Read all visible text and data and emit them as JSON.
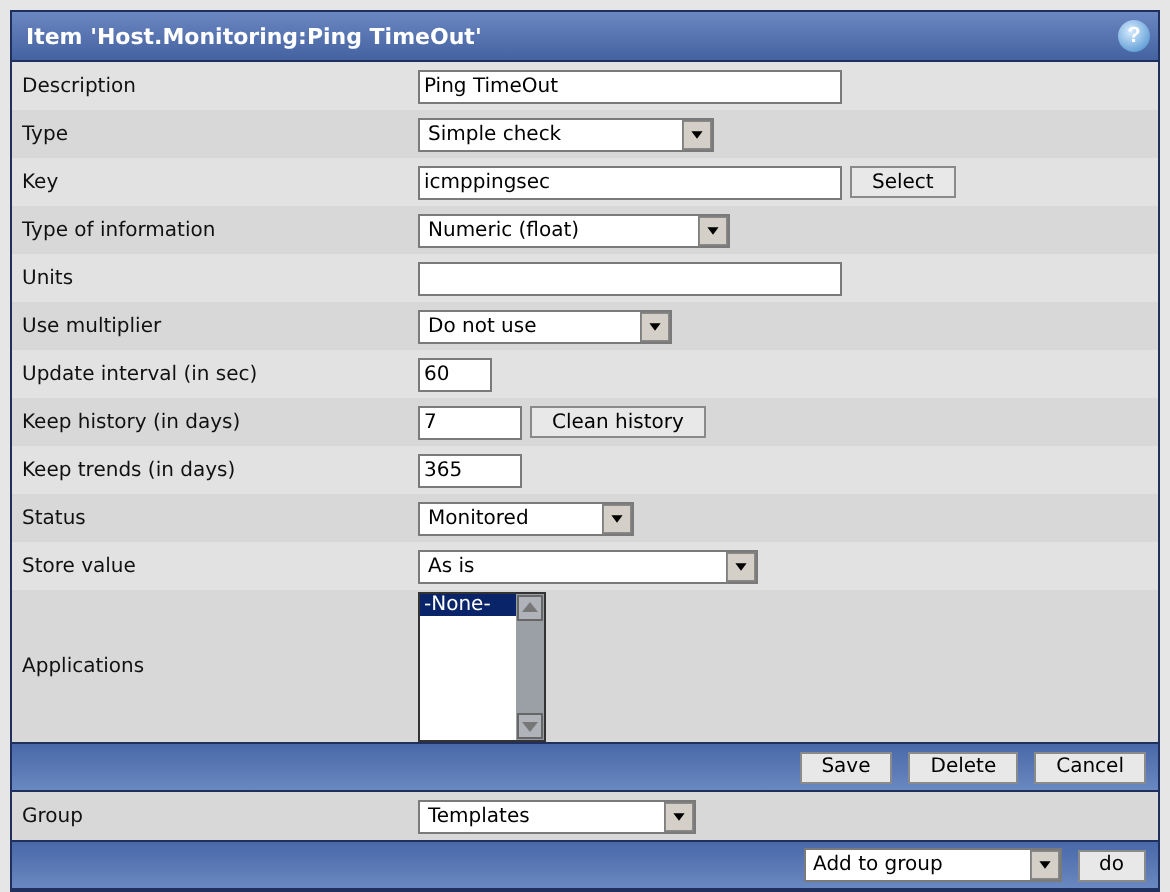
{
  "window": {
    "title": "Item 'Host.Monitoring:Ping TimeOut'",
    "help_button": "?"
  },
  "rows": [
    {
      "label": "Description",
      "kind": "input",
      "value": "Ping TimeOut"
    },
    {
      "label": "Type",
      "kind": "select",
      "value": "Simple check"
    },
    {
      "label": "Key",
      "kind": "input",
      "value": "icmppingsec",
      "button": "Select"
    },
    {
      "label": "Type of information",
      "kind": "select",
      "value": "Numeric (float)"
    },
    {
      "label": "Units",
      "kind": "input",
      "value": ""
    },
    {
      "label": "Use multiplier",
      "kind": "select",
      "value": "Do not use"
    },
    {
      "label": "Update interval (in sec)",
      "kind": "input",
      "value": "60"
    },
    {
      "label": "Keep history (in days)",
      "kind": "input",
      "value": "7",
      "button": "Clean history"
    },
    {
      "label": "Keep trends (in days)",
      "kind": "input",
      "value": "365"
    },
    {
      "label": "Status",
      "kind": "select",
      "value": "Monitored"
    },
    {
      "label": "Store value",
      "kind": "select",
      "value": "As is"
    },
    {
      "label": "Applications",
      "kind": "list",
      "items": [
        {
          "label": "-None-",
          "selected": true
        }
      ]
    }
  ],
  "actions": [
    "Save",
    "Delete",
    "Cancel"
  ],
  "group": {
    "label": "Group",
    "value": "Templates"
  },
  "group_action": {
    "value": "Add to group",
    "button": "do"
  }
}
